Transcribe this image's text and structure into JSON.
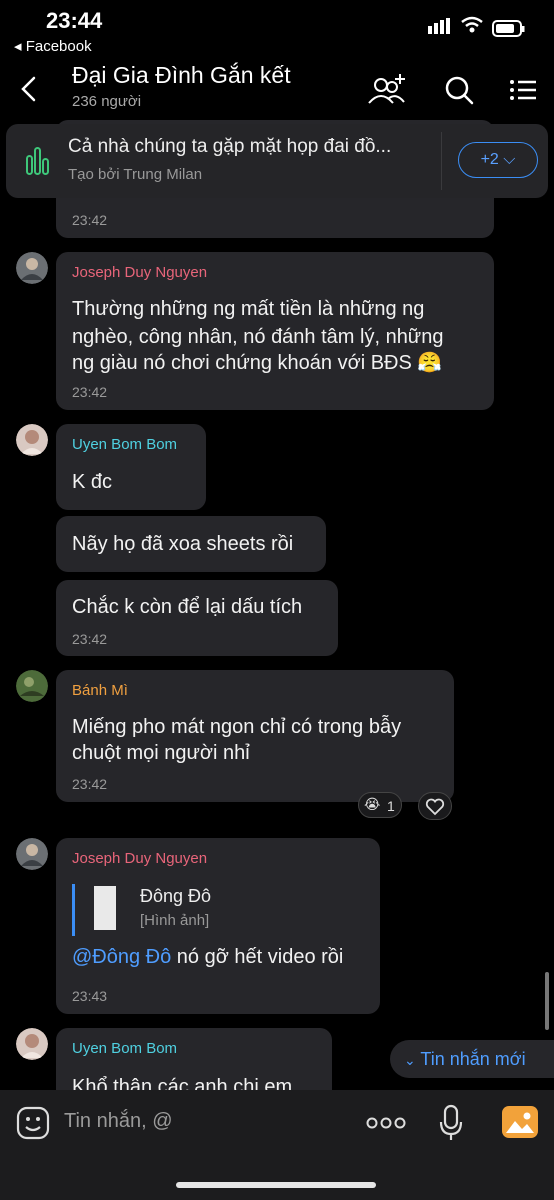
{
  "status": {
    "time": "23:44",
    "back_app": "◂ Facebook"
  },
  "header": {
    "title": "Đại Gia Đình Gắn kết",
    "members": "236 người"
  },
  "pinned": {
    "text": "Cả nhà chúng ta gặp mặt họp đai đồ...",
    "creator": "Tạo bởi Trung Milan",
    "more": "+2 ⌵"
  },
  "messages": [
    {
      "time": "23:42"
    },
    {
      "sender": "Joseph Duy Nguyen",
      "lines": [
        "Thường những ng mất tiền là những ng",
        "nghèo, công nhân, nó đánh tâm lý, những",
        "ng giàu nó chơi chứng khoán với BĐS 😤"
      ],
      "time": "23:42"
    },
    {
      "sender": "Uyen Bom Bom",
      "text": "K đc"
    },
    {
      "text": "Nãy họ đã xoa sheets rồi"
    },
    {
      "text": "Chắc k còn để lại dấu tích",
      "time": "23:42"
    },
    {
      "sender": "Bánh Mì",
      "lines": [
        "Miếng pho mát ngon chỉ có trong bẫy",
        "chuột mọi người nhỉ"
      ],
      "time": "23:42",
      "reaction_emoji": "😭",
      "reaction_count": "1"
    },
    {
      "sender": "Joseph Duy Nguyen",
      "quote_name": "Đông Đô",
      "quote_sub": "[Hình ảnh]",
      "mention": "@Đông Đô",
      "text": " nó gỡ hết video rồi",
      "time": "23:43"
    },
    {
      "sender": "Uyen Bom Bom",
      "text": "Khổ thân các anh chị em"
    }
  ],
  "new_messages": "Tin nhắn mới",
  "composer": {
    "placeholder": "Tin nhắn, @"
  },
  "colors": {
    "accent": "#3b8ef5",
    "bubble": "#26262a",
    "joseph": "#e8657a",
    "uyen": "#4fd0e0",
    "banhmi": "#f0a040"
  }
}
